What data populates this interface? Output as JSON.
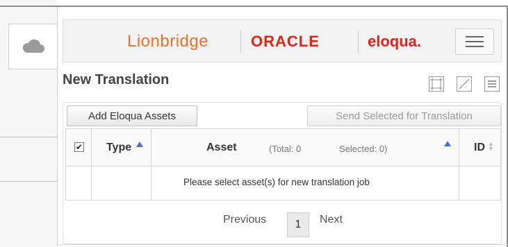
{
  "brand": {
    "lionbridge": "Lionbridge",
    "oracle": "ORACLE",
    "eloqua": "eloqua.",
    "colors": {
      "lionbridge": "#e8732b",
      "oracle": "#e2231a"
    }
  },
  "icons": {
    "sidebar": "cloud-icon",
    "menu": "hamburger-menu-icon",
    "title_actions": [
      "expand-frame-icon",
      "resize-diagonal-icon",
      "list-menu-icon"
    ]
  },
  "page": {
    "title": "New Translation"
  },
  "toolbar": {
    "add_label": "Add Eloqua Assets",
    "send_label": "Send Selected for Translation"
  },
  "grid": {
    "columns": {
      "type": "Type",
      "asset": "Asset",
      "id": "ID"
    },
    "totals": {
      "total": "(Total: 0",
      "selected": "Selected: 0)"
    },
    "header_checkbox": "✔",
    "empty_message": "Please select asset(s) for new translation job"
  },
  "pagination": {
    "previous": "Previous",
    "current": "1",
    "next": "Next"
  },
  "accent": "#4a6fd1"
}
